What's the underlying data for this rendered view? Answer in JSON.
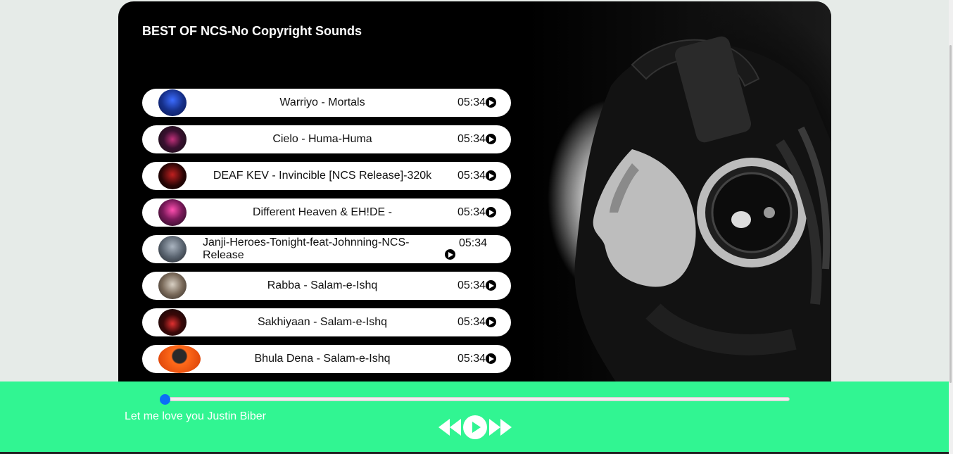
{
  "playlist": {
    "title": "BEST OF NCS-No Copyright Sounds",
    "tracks": [
      {
        "name": "Warriyo - Mortals",
        "time": "05:34",
        "thumb_color": "#1a3a9a"
      },
      {
        "name": "Cielo - Huma-Huma",
        "time": "05:34",
        "thumb_color": "#5a1a4a"
      },
      {
        "name": "DEAF KEV - Invincible [NCS Release]-320k",
        "time": "05:34",
        "thumb_color": "#3a0a0a"
      },
      {
        "name": "Different Heaven & EH!DE -",
        "time": "05:34",
        "thumb_color": "#8a2a6a"
      },
      {
        "name": "Janji-Heroes-Tonight-feat-Johnning-NCS-Release",
        "time": "05:34",
        "thumb_color": "#6a7480"
      },
      {
        "name": "Rabba - Salam-e-Ishq",
        "time": "05:34",
        "thumb_color": "#8a7a6a"
      },
      {
        "name": "Sakhiyaan - Salam-e-Ishq",
        "time": "05:34",
        "thumb_color": "#3a0a0a"
      },
      {
        "name": "Bhula Dena - Salam-e-Ishq",
        "time": "05:34",
        "thumb_color": "#e85010"
      }
    ]
  },
  "player": {
    "song_title": "Let me love you Justin Biber",
    "progress_fraction": 0.0,
    "bar_color": "#31f592",
    "knob_color": "#0b6ff5",
    "controls": [
      "previous-icon",
      "play-icon",
      "next-icon"
    ]
  }
}
